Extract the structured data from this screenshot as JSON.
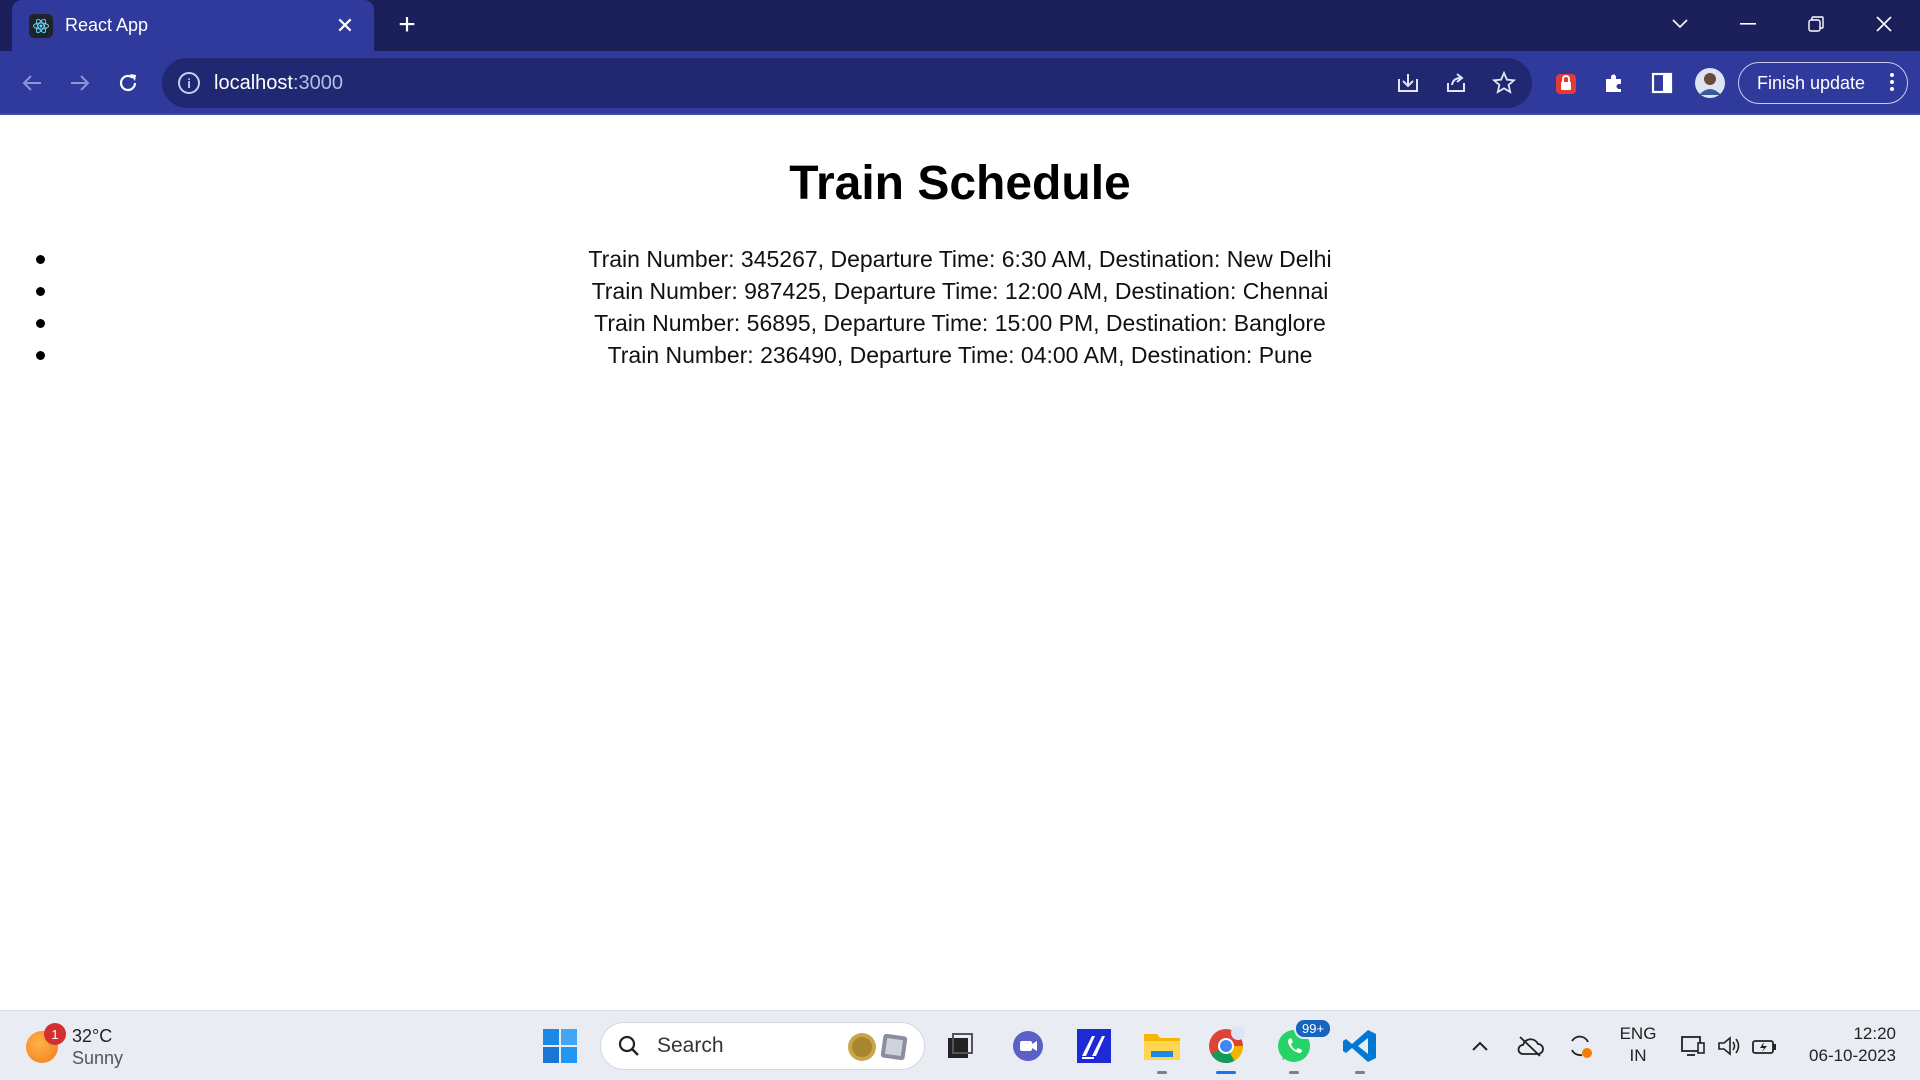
{
  "browser": {
    "tab_title": "React App",
    "url_host": "localhost",
    "url_port": ":3000",
    "finish_update_label": "Finish update"
  },
  "page": {
    "title": "Train Schedule",
    "trains": [
      "Train Number: 345267, Departure Time: 6:30 AM, Destination: New Delhi",
      "Train Number: 987425, Departure Time: 12:00 AM, Destination: Chennai",
      "Train Number: 56895, Departure Time: 15:00 PM, Destination: Banglore",
      "Train Number: 236490, Departure Time: 04:00 AM, Destination: Pune"
    ]
  },
  "taskbar": {
    "weather_temp": "32°C",
    "weather_condition": "Sunny",
    "weather_badge": "1",
    "search_placeholder": "Search",
    "whatsapp_badge": "99+",
    "lang_primary": "ENG",
    "lang_secondary": "IN",
    "time": "12:20",
    "date": "06-10-2023"
  },
  "colors": {
    "titlebar": "#1b1f5a",
    "toolbar": "#2f3a9c",
    "omnibox": "#1f2870",
    "taskbar": "#e9edf3"
  }
}
